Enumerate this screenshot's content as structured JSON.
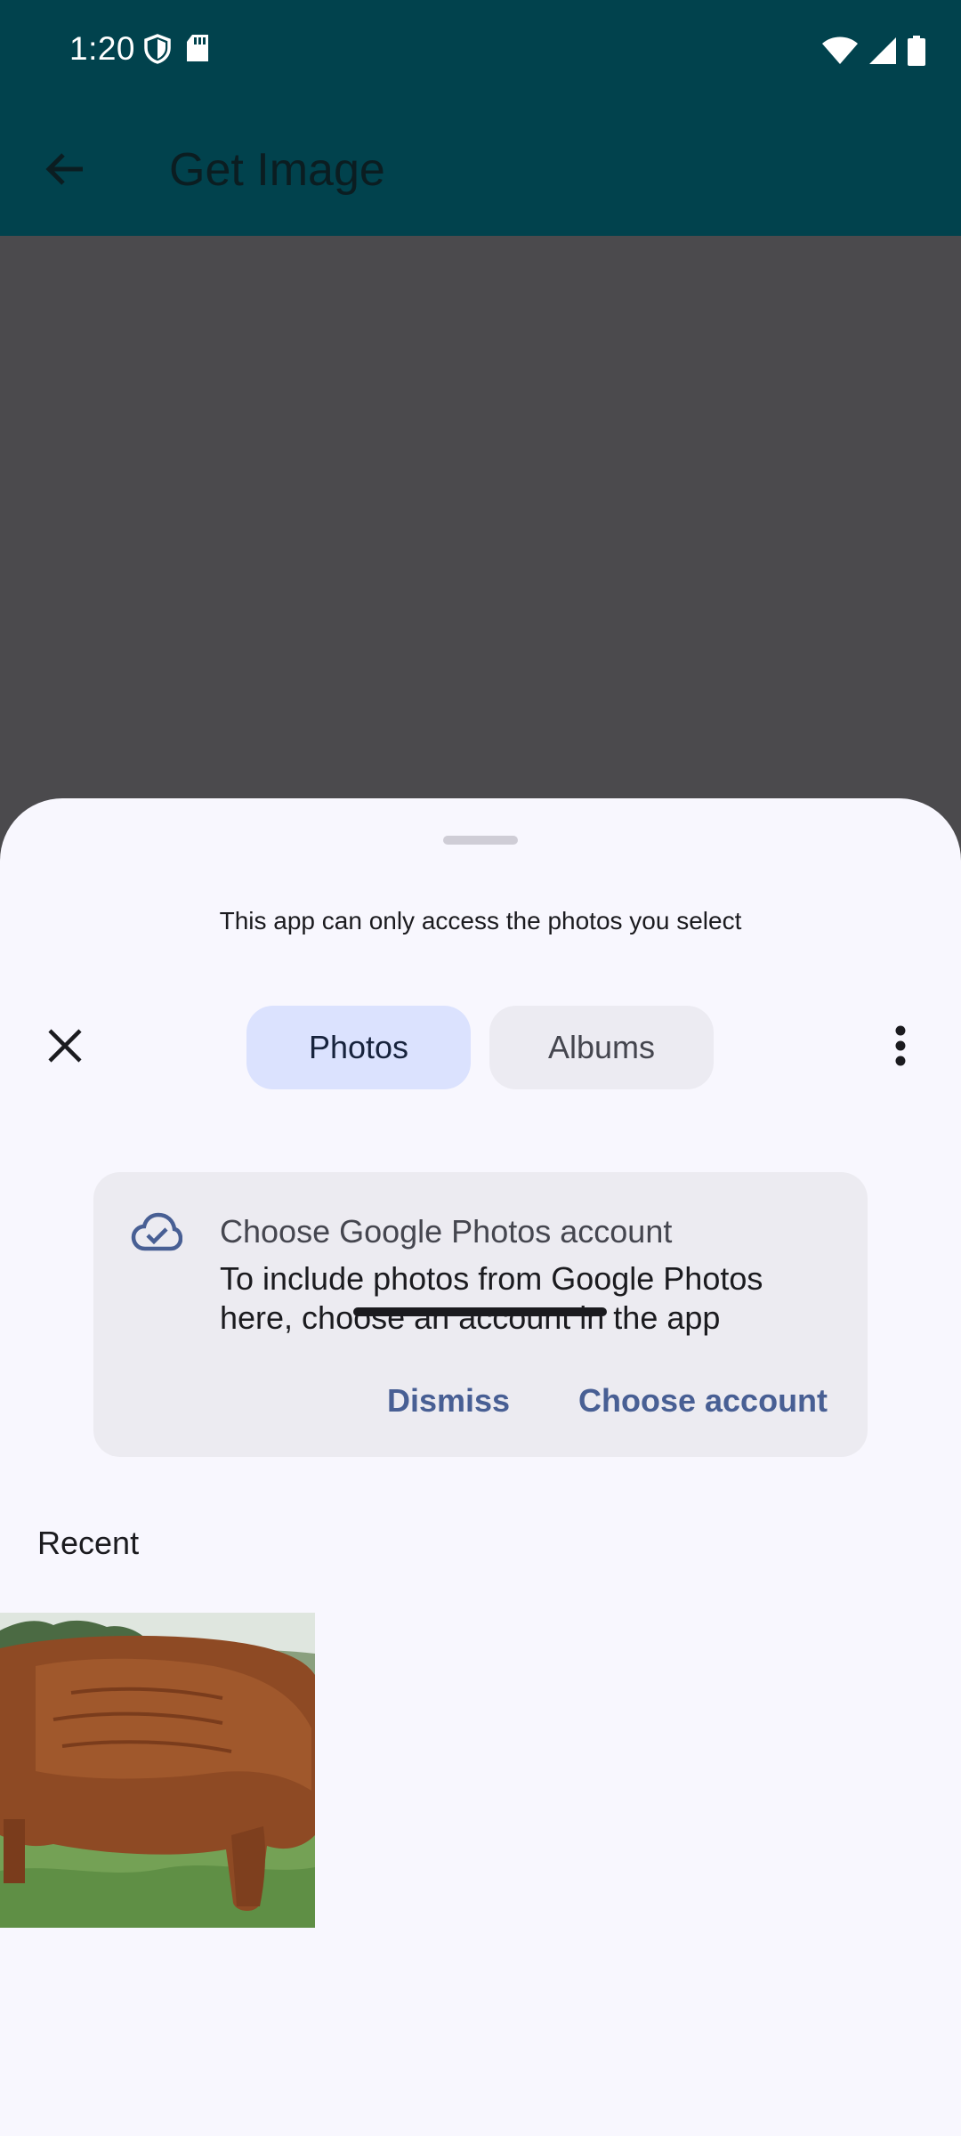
{
  "status_bar": {
    "time": "1:20",
    "left_icons": [
      "shield-icon",
      "sd-card-icon"
    ],
    "right_icons": [
      "wifi-icon",
      "signal-icon",
      "battery-icon"
    ]
  },
  "app_bar": {
    "back_icon": "arrow-back-icon",
    "title": "Get Image",
    "background": "#01424d"
  },
  "sheet": {
    "subtitle": "This app can only access the photos you select",
    "close_icon": "close-icon",
    "tabs": [
      {
        "label": "Photos",
        "selected": true
      },
      {
        "label": "Albums",
        "selected": false
      }
    ],
    "overflow_icon": "more-vert-icon",
    "banner": {
      "icon": "cloud-check-icon",
      "title": "Choose Google Photos account",
      "body": "To include photos from Google Photos here, choose an account in the app",
      "dismiss_label": "Dismiss",
      "choose_label": "Choose account",
      "action_color": "#485f94"
    },
    "recent_label": "Recent",
    "photos": [
      {
        "description_icon": "photo-thumbnail",
        "subject": "brown bull on grass"
      }
    ]
  },
  "colors": {
    "accent": "#485f94",
    "selected_tab": "#dbe2fe",
    "sheet_background": "#f8f7fe"
  }
}
